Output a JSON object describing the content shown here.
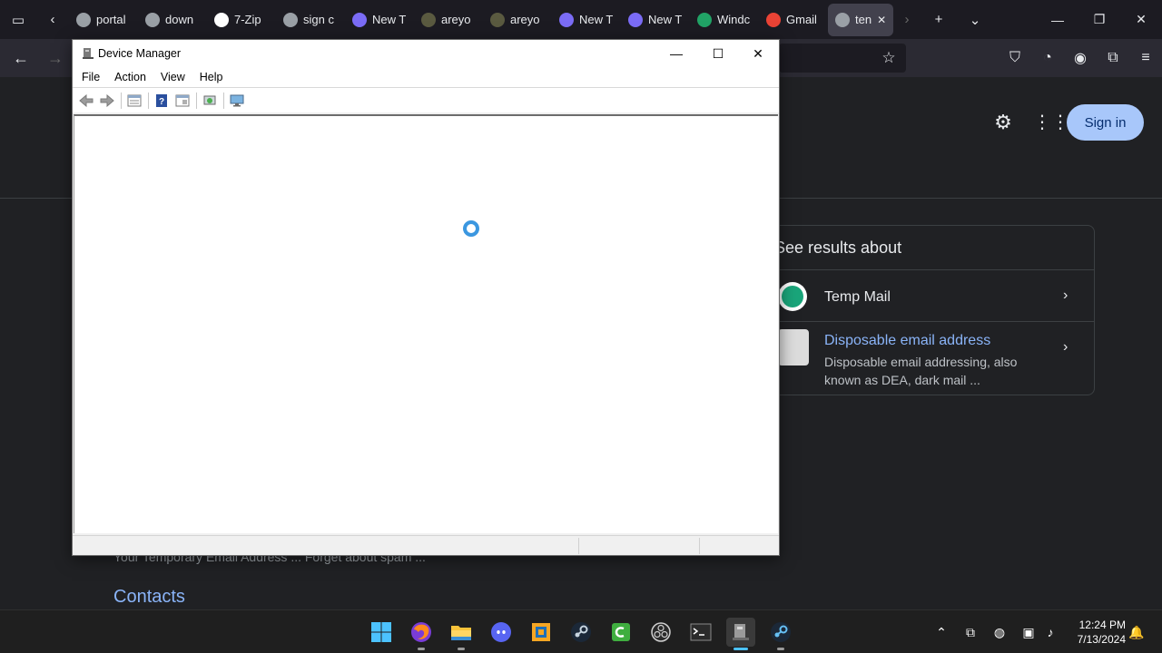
{
  "browser": {
    "tabs": [
      {
        "label": "portal",
        "color": "#9aa0a6"
      },
      {
        "label": "down",
        "color": "#9aa0a6"
      },
      {
        "label": "7-Zip",
        "color": "#ffffff"
      },
      {
        "label": "sign c",
        "color": "#9aa0a6"
      },
      {
        "label": "New T",
        "color": "#7b6cf6"
      },
      {
        "label": "areyo",
        "color": "#5a5a40"
      },
      {
        "label": "areyo",
        "color": "#5a5a40"
      },
      {
        "label": "New T",
        "color": "#7b6cf6"
      },
      {
        "label": "New T",
        "color": "#7b6cf6"
      },
      {
        "label": "Windc",
        "color": "#21a366"
      },
      {
        "label": "Gmail",
        "color": "#ea4335"
      }
    ],
    "active_tab": {
      "label": "ten",
      "color": "#9aa0a6"
    },
    "window_controls": {
      "minimize": "—",
      "restore": "❐",
      "close": "✕"
    }
  },
  "google": {
    "signin_label": "Sign in",
    "side_panel": {
      "title": "See results about",
      "item1": {
        "label": "Temp Mail"
      },
      "item2": {
        "link": "Disposable email address",
        "desc": "Disposable email addressing, also known as DEA, dark mail ..."
      }
    },
    "snippet": "Your Temporary Email Address ... Forget about spam ...",
    "contacts": "Contacts"
  },
  "device_manager": {
    "title": "Device Manager",
    "menu": [
      "File",
      "Action",
      "View",
      "Help"
    ],
    "toolbar_icons": [
      "back-arrow-icon",
      "forward-arrow-icon",
      "properties-icon",
      "help-icon",
      "view-icon",
      "scan-hardware-icon",
      "monitor-icon"
    ],
    "loading": true
  },
  "taskbar": {
    "apps": [
      "start-icon",
      "firefox-icon",
      "file-explorer-icon",
      "discord-icon",
      "virtualbox-icon",
      "steam-icon",
      "camtasia-icon",
      "obs-icon",
      "terminal-icon",
      "device-manager-icon",
      "steam-icon"
    ],
    "active_app": "device-manager-icon",
    "clock_time": "12:24 PM",
    "clock_date": "7/13/2024"
  }
}
